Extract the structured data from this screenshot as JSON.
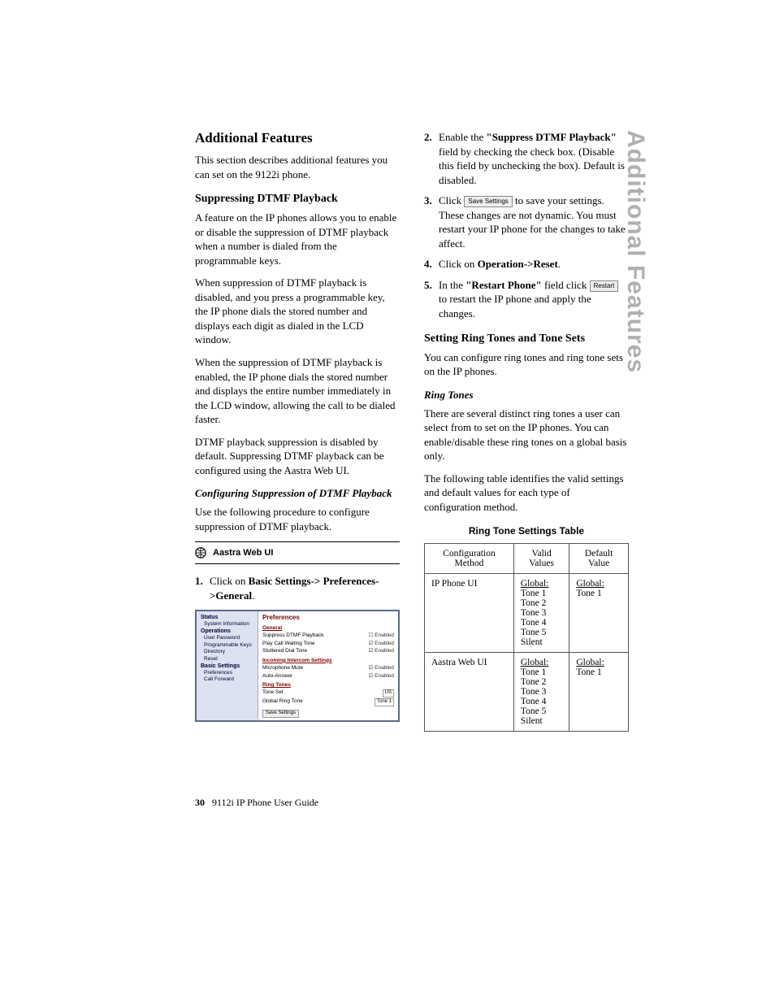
{
  "sideTitle": "Additional Features",
  "left": {
    "title": "Additional Features",
    "intro": "This section describes additional features you can set on the 9122i phone.",
    "h2a": "Suppressing DTMF Playback",
    "p1": "A feature on the IP phones allows you to enable or disable the suppression of DTMF playback when a number is dialed from the programmable keys.",
    "p2": "When suppression of DTMF playback is disabled, and you press a programmable key, the IP phone dials the stored number and displays each digit as dialed in the LCD window.",
    "p3": "When the suppression of DTMF playback is enabled, the IP phone dials the stored number and displays the entire number immediately in the LCD window, allowing the call to be dialed faster.",
    "p4": "DTMF playback suppression is disabled by default. Suppressing DTMF playback can be configured using the Aastra Web UI.",
    "h3a": "Configuring Suppression of DTMF Playback",
    "p5": "Use the following procedure to configure suppression of DTMF playback.",
    "webui": "Aastra Web UI",
    "step1a": "Click on ",
    "step1b": "Basic Settings-> Preferences->General",
    "step1c": "."
  },
  "right": {
    "step2a": "Enable the ",
    "step2b": "\"Suppress DTMF Playback\"",
    "step2c": " field by checking the check box. (Disable this field by unchecking the box). Default is disabled.",
    "step3a": "Click ",
    "step3btn": "Save Settings",
    "step3b": " to save your settings. These changes are not dynamic. You must restart your IP phone for the changes to take affect.",
    "step4a": "Click on ",
    "step4b": "Operation->Reset",
    "step4c": ".",
    "step5a": "In the ",
    "step5b": "\"Restart Phone\"",
    "step5c": " field click ",
    "step5btn": "Restart",
    "step5d": " to restart the IP phone and apply the changes.",
    "h2b": "Setting Ring Tones and Tone Sets",
    "p6": "You can configure ring tones and ring tone sets on the IP phones.",
    "h3b": "Ring Tones",
    "p7": "There are several distinct ring tones a user can select from to set on the IP phones. You can enable/disable these ring tones on a global basis only.",
    "p8": "The following table identifies the valid settings and default values for each type of configuration method.",
    "tableCaption": "Ring Tone Settings Table",
    "th1": "Configuration Method",
    "th2": "Valid Values",
    "th3": "Default Value",
    "rows": [
      {
        "method": "IP Phone UI",
        "valid_label": "Global:",
        "valid_items": [
          "Tone 1",
          "Tone 2",
          "Tone 3",
          "Tone 4",
          "Tone 5",
          "Silent"
        ],
        "def_label": "Global:",
        "def_item": "Tone 1"
      },
      {
        "method": "Aastra Web UI",
        "valid_label": "Global:",
        "valid_items": [
          "Tone 1",
          "Tone 2",
          "Tone 3",
          "Tone 4",
          "Tone 5",
          "Silent"
        ],
        "def_label": "Global:",
        "def_item": "Tone 1"
      }
    ]
  },
  "screenshot": {
    "nav": {
      "status": "Status",
      "status_items": [
        "System Information"
      ],
      "operations": "Operations",
      "operations_items": [
        "User Password",
        "Programmable Keys",
        "Directory",
        "Reset"
      ],
      "basic": "Basic Settings",
      "basic_items": [
        "Preferences",
        "Call Forward"
      ]
    },
    "main": {
      "title": "Preferences",
      "g1": "General",
      "rows1": [
        {
          "l": "Suppress DTMF Playback",
          "r": "☐ Enabled"
        },
        {
          "l": "Play Call Waiting Tone",
          "r": "☑ Enabled"
        },
        {
          "l": "Stuttered Dial Tone",
          "r": "☑ Enabled"
        }
      ],
      "g2": "Incoming Intercom Settings",
      "rows2": [
        {
          "l": "Microphone Mute",
          "r": "☑ Enabled"
        },
        {
          "l": "Auto-Answer",
          "r": "☑ Enabled"
        }
      ],
      "g3": "Ring Tones",
      "rows3": [
        {
          "l": "Tone Set",
          "r": "US"
        },
        {
          "l": "Global Ring Tone",
          "r": "Tone 1"
        }
      ],
      "save": "Save Settings"
    }
  },
  "footer": {
    "page": "30",
    "doc": "9112i IP Phone User Guide"
  }
}
